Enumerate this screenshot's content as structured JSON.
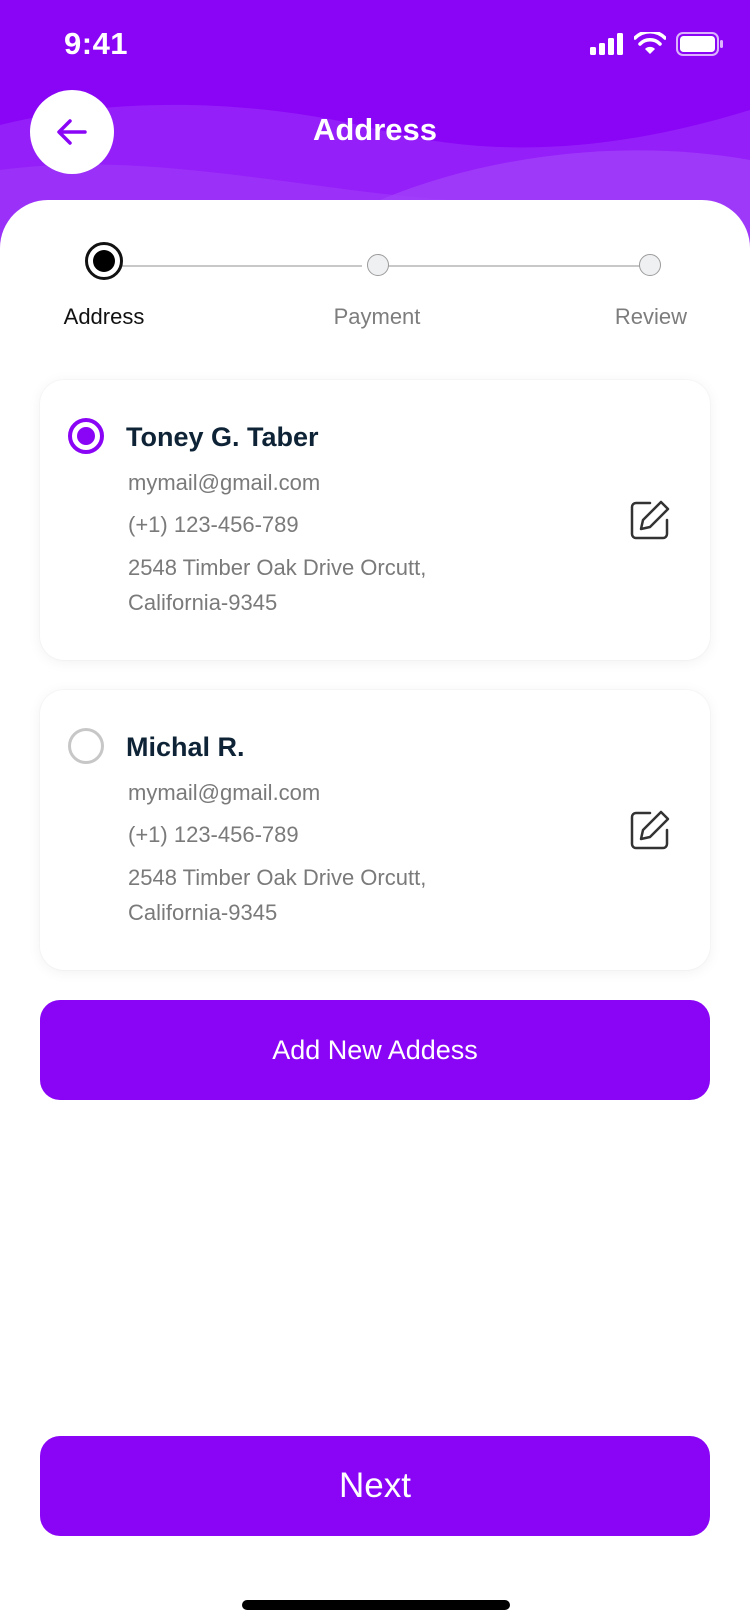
{
  "status_bar": {
    "time": "9:41"
  },
  "header": {
    "title": "Address"
  },
  "stepper": {
    "steps": [
      {
        "label": "Address",
        "active": true
      },
      {
        "label": "Payment",
        "active": false
      },
      {
        "label": "Review",
        "active": false
      }
    ]
  },
  "addresses": [
    {
      "name": "Toney G. Taber",
      "email": "mymail@gmail.com",
      "phone": "(+1) 123-456-789",
      "address_line1": "2548 Timber Oak Drive Orcutt,",
      "address_line2": "California-9345",
      "selected": true
    },
    {
      "name": "Michal R.",
      "email": "mymail@gmail.com",
      "phone": "(+1) 123-456-789",
      "address_line1": "2548 Timber Oak Drive Orcutt,",
      "address_line2": "California-9345",
      "selected": false
    }
  ],
  "add_button_label": "Add New Addess",
  "next_button_label": "Next",
  "colors": {
    "accent": "#8a05f6",
    "name_text": "#0e2336",
    "muted_text": "#7a7a7a"
  }
}
